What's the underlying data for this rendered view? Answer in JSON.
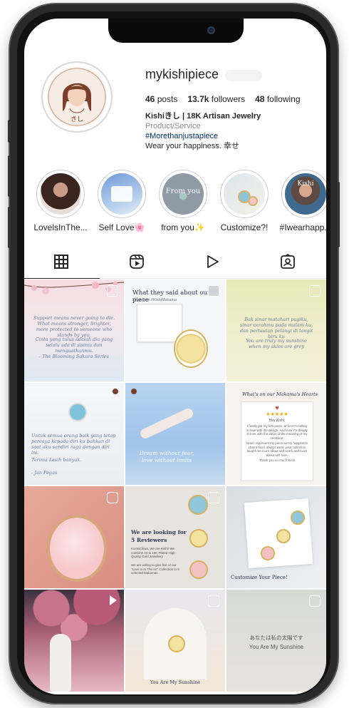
{
  "profile": {
    "username": "mykishipiece",
    "posts_count": "46",
    "posts_label": "posts",
    "followers_count": "13.7k",
    "followers_label": "followers",
    "following_count": "48",
    "following_label": "following",
    "display_name": "Kishiきし | 18K Artisan Jewelry",
    "category": "Product/Service",
    "hashtag": "#Morethanjustapiece",
    "tagline": "Wear your happiness. 幸せ",
    "avatar_caption": "きし"
  },
  "highlights": [
    {
      "label": "LovelsInThe..."
    },
    {
      "label": "Self Love🌸"
    },
    {
      "label": "from you✨"
    },
    {
      "label": "Customize?!"
    },
    {
      "label": "#Iwearhapp..."
    }
  ],
  "highlight_overlays": {
    "from_you": "From you",
    "kishi": "Kishi"
  },
  "tabs": [
    "grid-icon",
    "reels-icon",
    "play-icon",
    "tagged-icon"
  ],
  "posts": {
    "p1_text_a": "Support means never going to die. What means stronger, brighter, more protected to someone who stands by you.",
    "p1_text_b": "Cinta yang tulus adalah dia yang selalu ada di sisimu dan menguatkanmu.",
    "p1_sig": "- The Blooming Sakura Series",
    "p2_title": "What they said about our piece",
    "p2_sub": "Love from #KishiMakama",
    "p3_text_a": "Bak sinar matahari pagiku, sinar cerahmu pada malam ku, dan pertautan pelangi di langit biru ku",
    "p3_text_b": "You are truly my sunshine when my skies are grey",
    "p4_text_a": "Untuk semua orang baik yang tetap percaya kepada diri ku bahkan di saat aku sendiri ragu dengan diri ini.",
    "p4_text_b": "Terima kasih banyak.",
    "p4_sig": "- Jan Pegas",
    "p5_text": "Dream without fear, love without limits",
    "p6_title": "What's on our Makama's Hearts",
    "p6_hello": "Hey Kishi,",
    "p6_body": "I finally got my first piece, at first I'm falling in love with the design. And now I'm deeply in love with the ideas of the meaning of my necklace.",
    "p6_body2": "Now I represent my piece as my happiness charm that I always wear, your collection taught me more about self worth and more about self love.",
    "p6_thanks": "Thank you so much Kishi",
    "p8_title_a": "We are looking for",
    "p8_title_b": "5 Reviewers",
    "p8_body": "Kon'nichiwa, We are Kishi! We combine Art & 18K Plated High Quality Gold Jewellery",
    "p8_body2": "We are willing to give five of our \"Love Is In The Air\" Collection to 5 selected Makamas",
    "p9_text": "Customize Your Piece!",
    "p11_text": "You Are My Sunshine",
    "p12_jp": "あなたは私の太陽です",
    "p12_en": "You Are My Sunshine"
  },
  "colors": {
    "accent_link": "#00376b",
    "text": "#262626",
    "muted": "#8e8e8e"
  }
}
